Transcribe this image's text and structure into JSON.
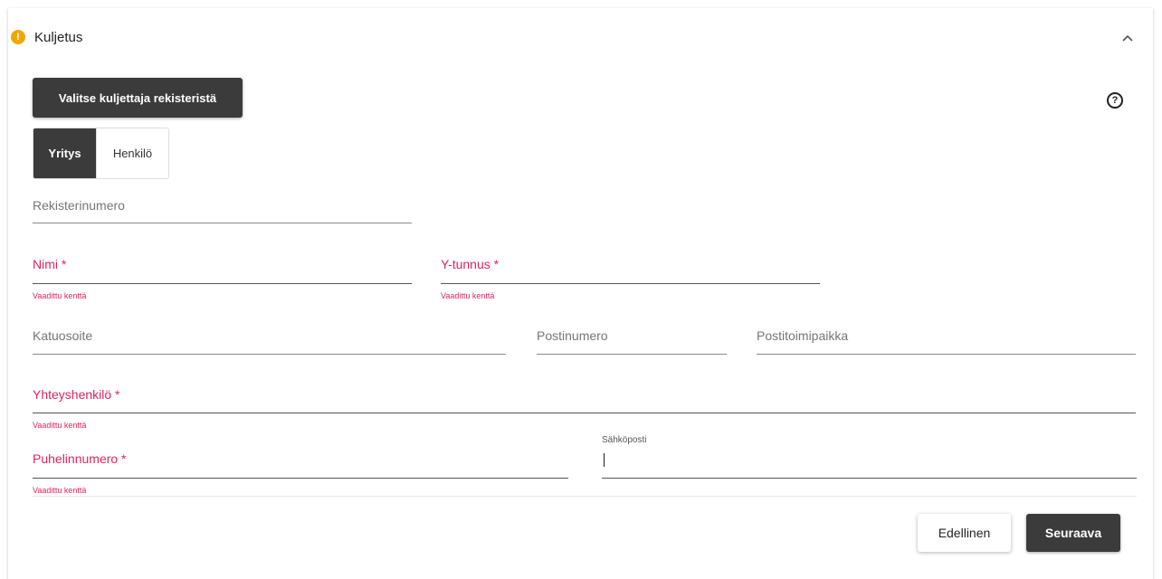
{
  "section": {
    "title": "Kuljetus",
    "warning_symbol": "!"
  },
  "buttons": {
    "select_driver": "Valitse kuljettaja rekisteristä",
    "previous": "Edellinen",
    "next": "Seuraava"
  },
  "toggle": {
    "company": "Yritys",
    "person": "Henkilö",
    "selected": "Yritys"
  },
  "help_symbol": "?",
  "fields": {
    "register_number": {
      "label": "Rekisterinumero"
    },
    "name": {
      "label": "Nimi *",
      "error": "Vaadittu kenttä"
    },
    "business_id": {
      "label": "Y-tunnus *",
      "error": "Vaadittu kenttä"
    },
    "street_address": {
      "label": "Katuosoite"
    },
    "postal_code": {
      "label": "Postinumero"
    },
    "city": {
      "label": "Postitoimipaikka"
    },
    "contact_person": {
      "label": "Yhteyshenkilö *",
      "error": "Vaadittu kenttä"
    },
    "phone": {
      "label": "Puhelinnumero *",
      "error": "Vaadittu kenttä"
    },
    "email": {
      "label": "Sähköposti",
      "value": ""
    }
  },
  "colors": {
    "error": "#e0245e",
    "warning": "#f0a800",
    "dark_button": "#3b3b3b"
  },
  "icons": {
    "warning": "warning-icon",
    "collapse": "chevron-up-icon",
    "help": "help-icon"
  }
}
